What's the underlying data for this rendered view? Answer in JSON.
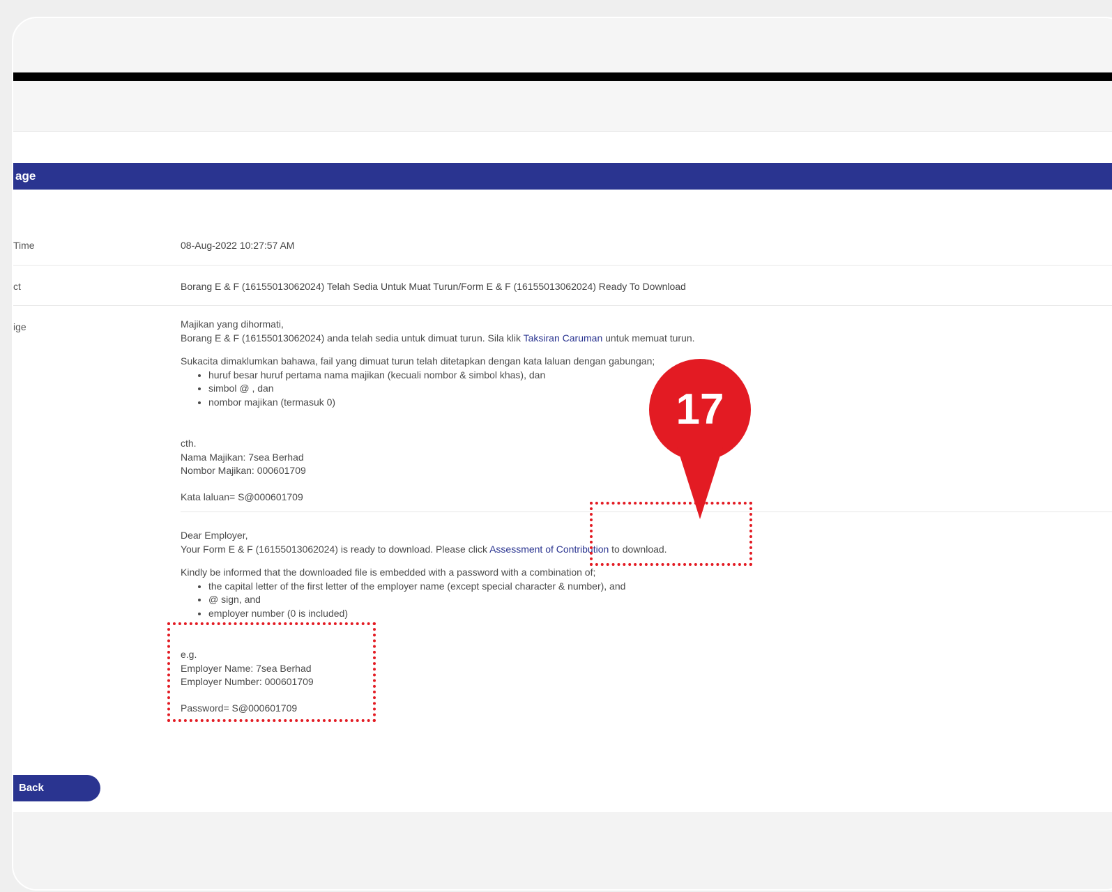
{
  "header": {
    "title": "age"
  },
  "rows": [
    {
      "label": "Time",
      "value": "08-Aug-2022 10:27:57 AM"
    },
    {
      "label": "ct",
      "value": "Borang E & F (16155013062024) Telah Sedia Untuk Muat Turun/Form E & F (16155013062024) Ready To Download"
    },
    {
      "label": "ige"
    }
  ],
  "message": {
    "malay": {
      "greeting": "Majikan yang dihormati,",
      "line1_before": "Borang E & F (16155013062024) anda telah sedia untuk dimuat turun. Sila klik ",
      "line1_link": "Taksiran Caruman",
      "line1_after": " untuk memuat turun.",
      "intro": "Sukacita dimaklumkan bahawa, fail yang dimuat turun telah ditetapkan dengan kata laluan dengan gabungan;",
      "bullets": [
        "huruf besar huruf pertama nama majikan (kecuali nombor & simbol khas), dan",
        "simbol @ , dan",
        "nombor majikan (termasuk 0)"
      ],
      "eg": "cth.",
      "name": "Nama Majikan: 7sea Berhad",
      "number": "Nombor Majikan: 000601709",
      "password": "Kata laluan= S@000601709"
    },
    "english": {
      "greeting": "Dear Employer,",
      "line1_before": "Your Form E & F (16155013062024) is ready to download. Please click ",
      "line1_link": "Assessment of Contribution",
      "line1_after": " to download.",
      "intro": "Kindly be informed that the downloaded file is embedded with a password with a combination of;",
      "bullets": [
        "the capital letter of the first letter of the employer name (except special character & number), and",
        "@ sign, and",
        "employer number (0 is included)"
      ],
      "eg": "e.g.",
      "name": "Employer Name: 7sea Berhad",
      "number": "Employer Number: 000601709",
      "password": "Password= S@000601709"
    }
  },
  "back_button": "Back",
  "annotation": {
    "step": "17",
    "color": "#e31b23"
  },
  "colors": {
    "accent": "#2a3490",
    "annotation": "#e31b23"
  }
}
